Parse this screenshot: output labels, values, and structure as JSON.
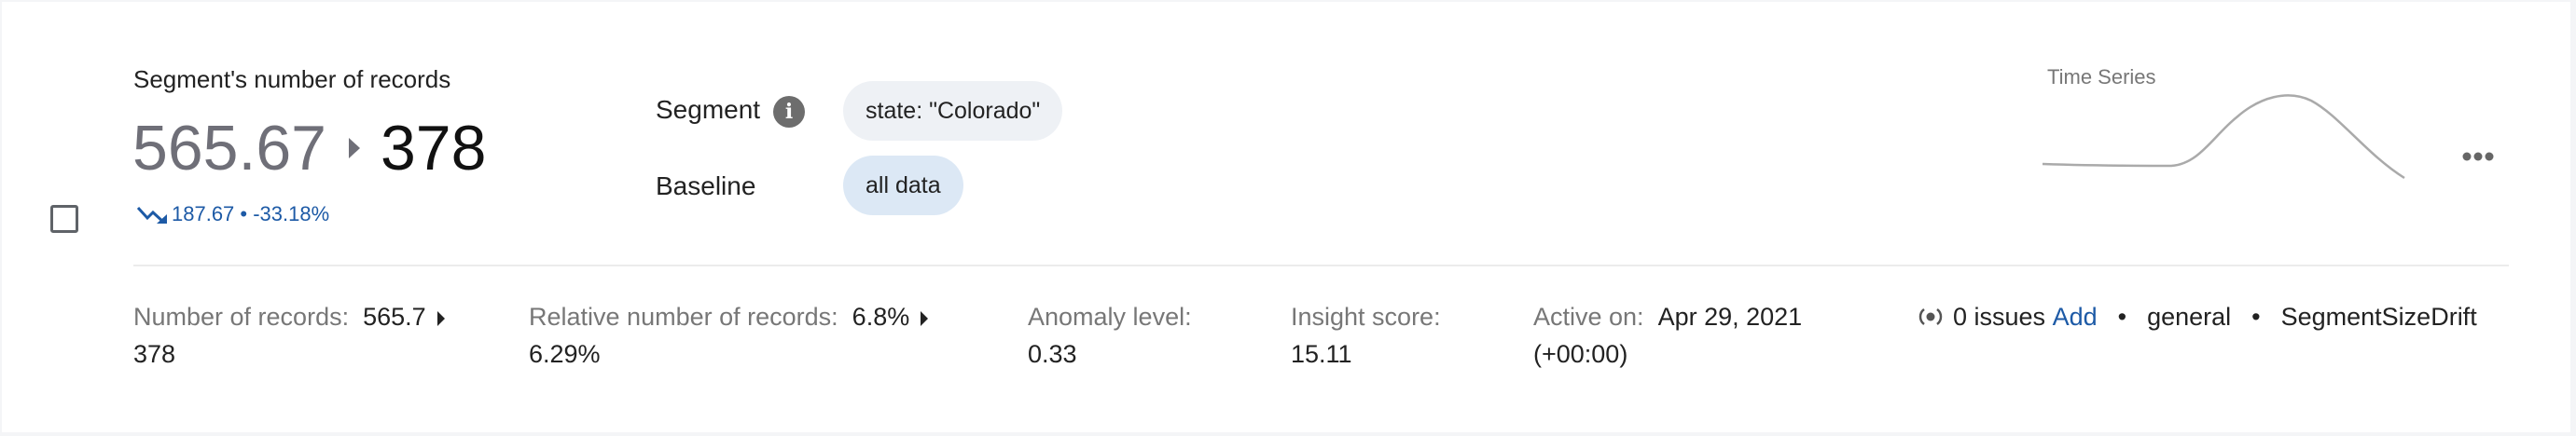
{
  "card": {
    "title": "Segment's number of records",
    "old_value": "565.67",
    "new_value": "378",
    "delta": "187.67 • -33.18%",
    "segment_label": "Segment",
    "segment_value": "state: \"Colorado\"",
    "baseline_label": "Baseline",
    "baseline_value": "all data",
    "timeseries_label": "Time Series",
    "metrics": {
      "records_label": "Number of records:",
      "records_old": "565.7",
      "records_new": "378",
      "relative_label": "Relative number of records:",
      "relative_old": "6.8%",
      "relative_new": "6.29%",
      "anomaly_label": "Anomaly level:",
      "anomaly_value": "0.33",
      "insight_label": "Insight score:",
      "insight_value": "15.11",
      "active_label": "Active on:",
      "active_date": "Apr 29, 2021",
      "active_tz": "(+00:00)"
    },
    "meta": {
      "issues": "0 issues",
      "add_link": "Add",
      "tag1": "general",
      "tag2": "SegmentSizeDrift",
      "separator": "•"
    }
  },
  "icons": {
    "info": "info-icon",
    "trend": "trending-down-icon",
    "more": "more-horizontal-icon",
    "issues": "radio-signal-icon"
  },
  "colors": {
    "link": "#1d5aa6",
    "segment_chip": "#eef1f5",
    "baseline_chip": "#dce8f5",
    "sparkline": "#aaaaaa"
  }
}
